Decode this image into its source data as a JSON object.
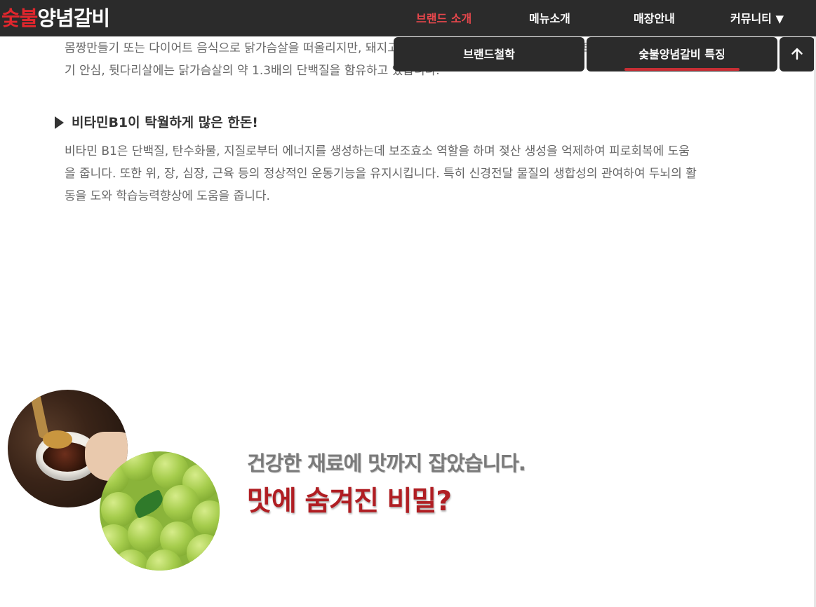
{
  "header": {
    "logo": {
      "part1": "숯불",
      "part2": "양념갈비"
    },
    "nav": [
      {
        "label": "브랜드 소개",
        "active": true
      },
      {
        "label": "메뉴소개",
        "active": false
      },
      {
        "label": "매장안내",
        "active": false
      },
      {
        "label": "커뮤니티",
        "dropdown_glyph": "▼",
        "active": false
      }
    ]
  },
  "submenu": {
    "items": [
      {
        "label": "브랜드철학",
        "active": false
      },
      {
        "label": "숯불양념갈비 특징",
        "active": true
      }
    ],
    "scroll_top_icon": "arrow-up-icon"
  },
  "content": {
    "intro_paragraph": "몸짱만들기 또는 다이어트 음식으로 닭가슴살을 떠올리지만, 돼지고기 저지방 부위도 아주 훌륭한 다이어트 식품입니다. 돼지고기 안심, 뒷다리살에는 닭가슴살의 약 1.3배의 단백질을 함유하고 있습니다.",
    "section_heading": "비타민B1이 탁월하게 많은 한돈!",
    "section_paragraph": "비타민 B1은 단백질, 탄수화물, 지질로부터 에너지를 생성하는데 보조효소 역할을 하며 젖산 생성을 억제하여 피로회복에 도움을 줍니다. 또한 위, 장, 심장, 근육 등의 정상적인 운동기능을 유지시킵니다. 특히 신경전달 물질의 생합성의 관여하여 두뇌의 활동을 도와 학습능력향상에 도움을 줍니다."
  },
  "promo": {
    "tagline": "건강한 재료에 맛까지 잡았습니다.",
    "headline": "맛에 숨겨진 비밀?"
  },
  "colors": {
    "nav_background": "#2b2b2b",
    "accent_red": "#e1262d",
    "headline_red": "#b01e23",
    "active_underline": "#c72e34"
  }
}
